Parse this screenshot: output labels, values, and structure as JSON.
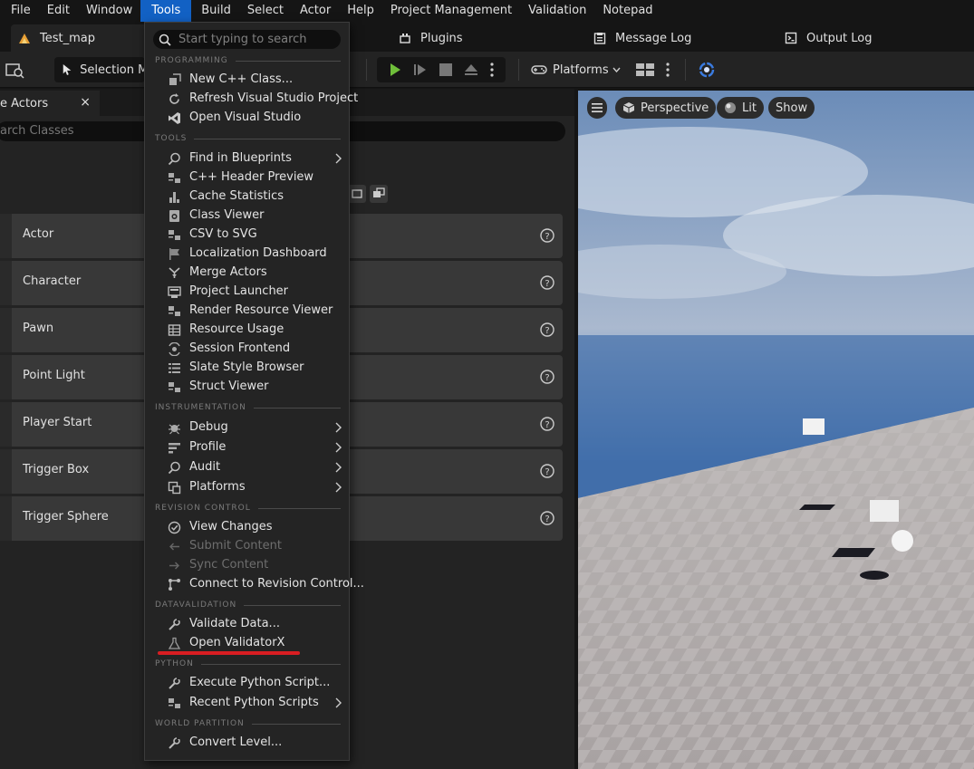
{
  "menubar": {
    "items": [
      "File",
      "Edit",
      "Window",
      "Tools",
      "Build",
      "Select",
      "Actor",
      "Help",
      "Project Management",
      "Validation",
      "Notepad"
    ],
    "active": "Tools"
  },
  "tabs": {
    "map": "Test_map",
    "plugins": "Plugins",
    "message_log": "Message Log",
    "output_log": "Output Log"
  },
  "toolbar": {
    "selection_mode": "Selection Mo",
    "platforms": "Platforms"
  },
  "place_actors": {
    "tab_label": "e Actors",
    "close_glyph": "×",
    "search_placeholder": "arch Classes",
    "items": [
      "Actor",
      "Character",
      "Pawn",
      "Point Light",
      "Player Start",
      "Trigger Box",
      "Trigger Sphere"
    ]
  },
  "viewport": {
    "perspective": "Perspective",
    "lit": "Lit",
    "show": "Show"
  },
  "tools_menu": {
    "search_placeholder": "Start typing to search",
    "sections": {
      "programming": "PROGRAMMING",
      "tools": "TOOLS",
      "instrumentation": "INSTRUMENTATION",
      "revision": "REVISION CONTROL",
      "datavalidation": "DATAVALIDATION",
      "python": "PYTHON",
      "world_partition": "WORLD PARTITION"
    },
    "programming": [
      "New C++ Class...",
      "Refresh Visual Studio Project",
      "Open Visual Studio"
    ],
    "tools": [
      "Find in Blueprints",
      "C++ Header Preview",
      "Cache Statistics",
      "Class Viewer",
      "CSV to SVG",
      "Localization Dashboard",
      "Merge Actors",
      "Project Launcher",
      "Render Resource Viewer",
      "Resource Usage",
      "Session Frontend",
      "Slate Style Browser",
      "Struct Viewer"
    ],
    "instrumentation": [
      "Debug",
      "Profile",
      "Audit",
      "Platforms"
    ],
    "revision": [
      "View Changes",
      "Submit Content",
      "Sync Content",
      "Connect to Revision Control..."
    ],
    "datavalidation": [
      "Validate Data...",
      "Open ValidatorX"
    ],
    "python": [
      "Execute Python Script...",
      "Recent Python Scripts"
    ],
    "world_partition": [
      "Convert Level..."
    ]
  },
  "colors": {
    "menu_highlight": "#1261c4",
    "play_green": "#6fbf3a",
    "annotation_red": "#d91d22"
  }
}
